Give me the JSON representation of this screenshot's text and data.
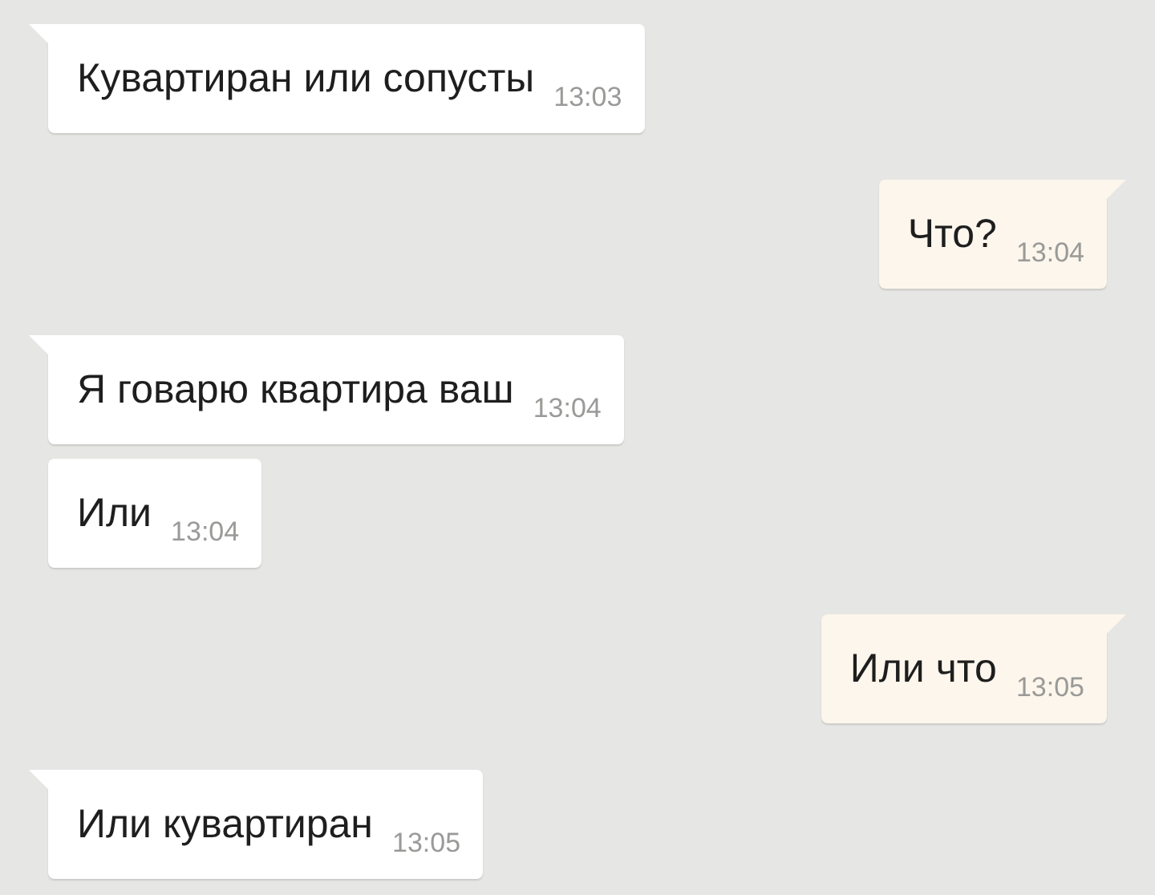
{
  "messages": [
    {
      "outgoing": false,
      "text": "Кувартиран или сопусты",
      "time": "13:03"
    },
    {
      "outgoing": true,
      "text": "Что?",
      "time": "13:04"
    },
    {
      "outgoing": false,
      "text": "Я говарю квартира ваш",
      "time": "13:04"
    },
    {
      "outgoing": false,
      "text": "Или",
      "time": "13:04"
    },
    {
      "outgoing": true,
      "text": "Или что",
      "time": "13:05"
    },
    {
      "outgoing": false,
      "text": "Или кувартиран",
      "time": "13:05"
    }
  ]
}
